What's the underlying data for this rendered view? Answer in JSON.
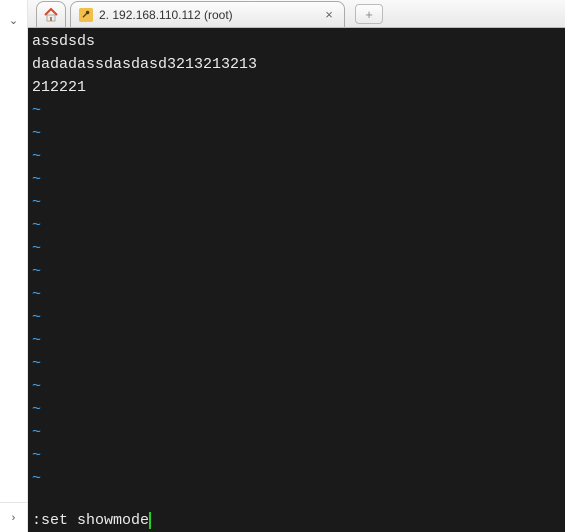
{
  "gutter": {
    "top_glyph": "⌄",
    "bottom_glyph": "›"
  },
  "tabs": {
    "active": {
      "label": "2. 192.168.110.112 (root)"
    }
  },
  "terminal": {
    "lines": [
      "assdsds",
      "dadadassdasdasd3213213213",
      "212221"
    ],
    "tilde": "~",
    "command": ":set showmode"
  },
  "colors": {
    "terminal_bg": "#1a1a1a",
    "terminal_fg": "#eaeaea",
    "tilde": "#3fa6f5",
    "cursor": "#25d025"
  }
}
